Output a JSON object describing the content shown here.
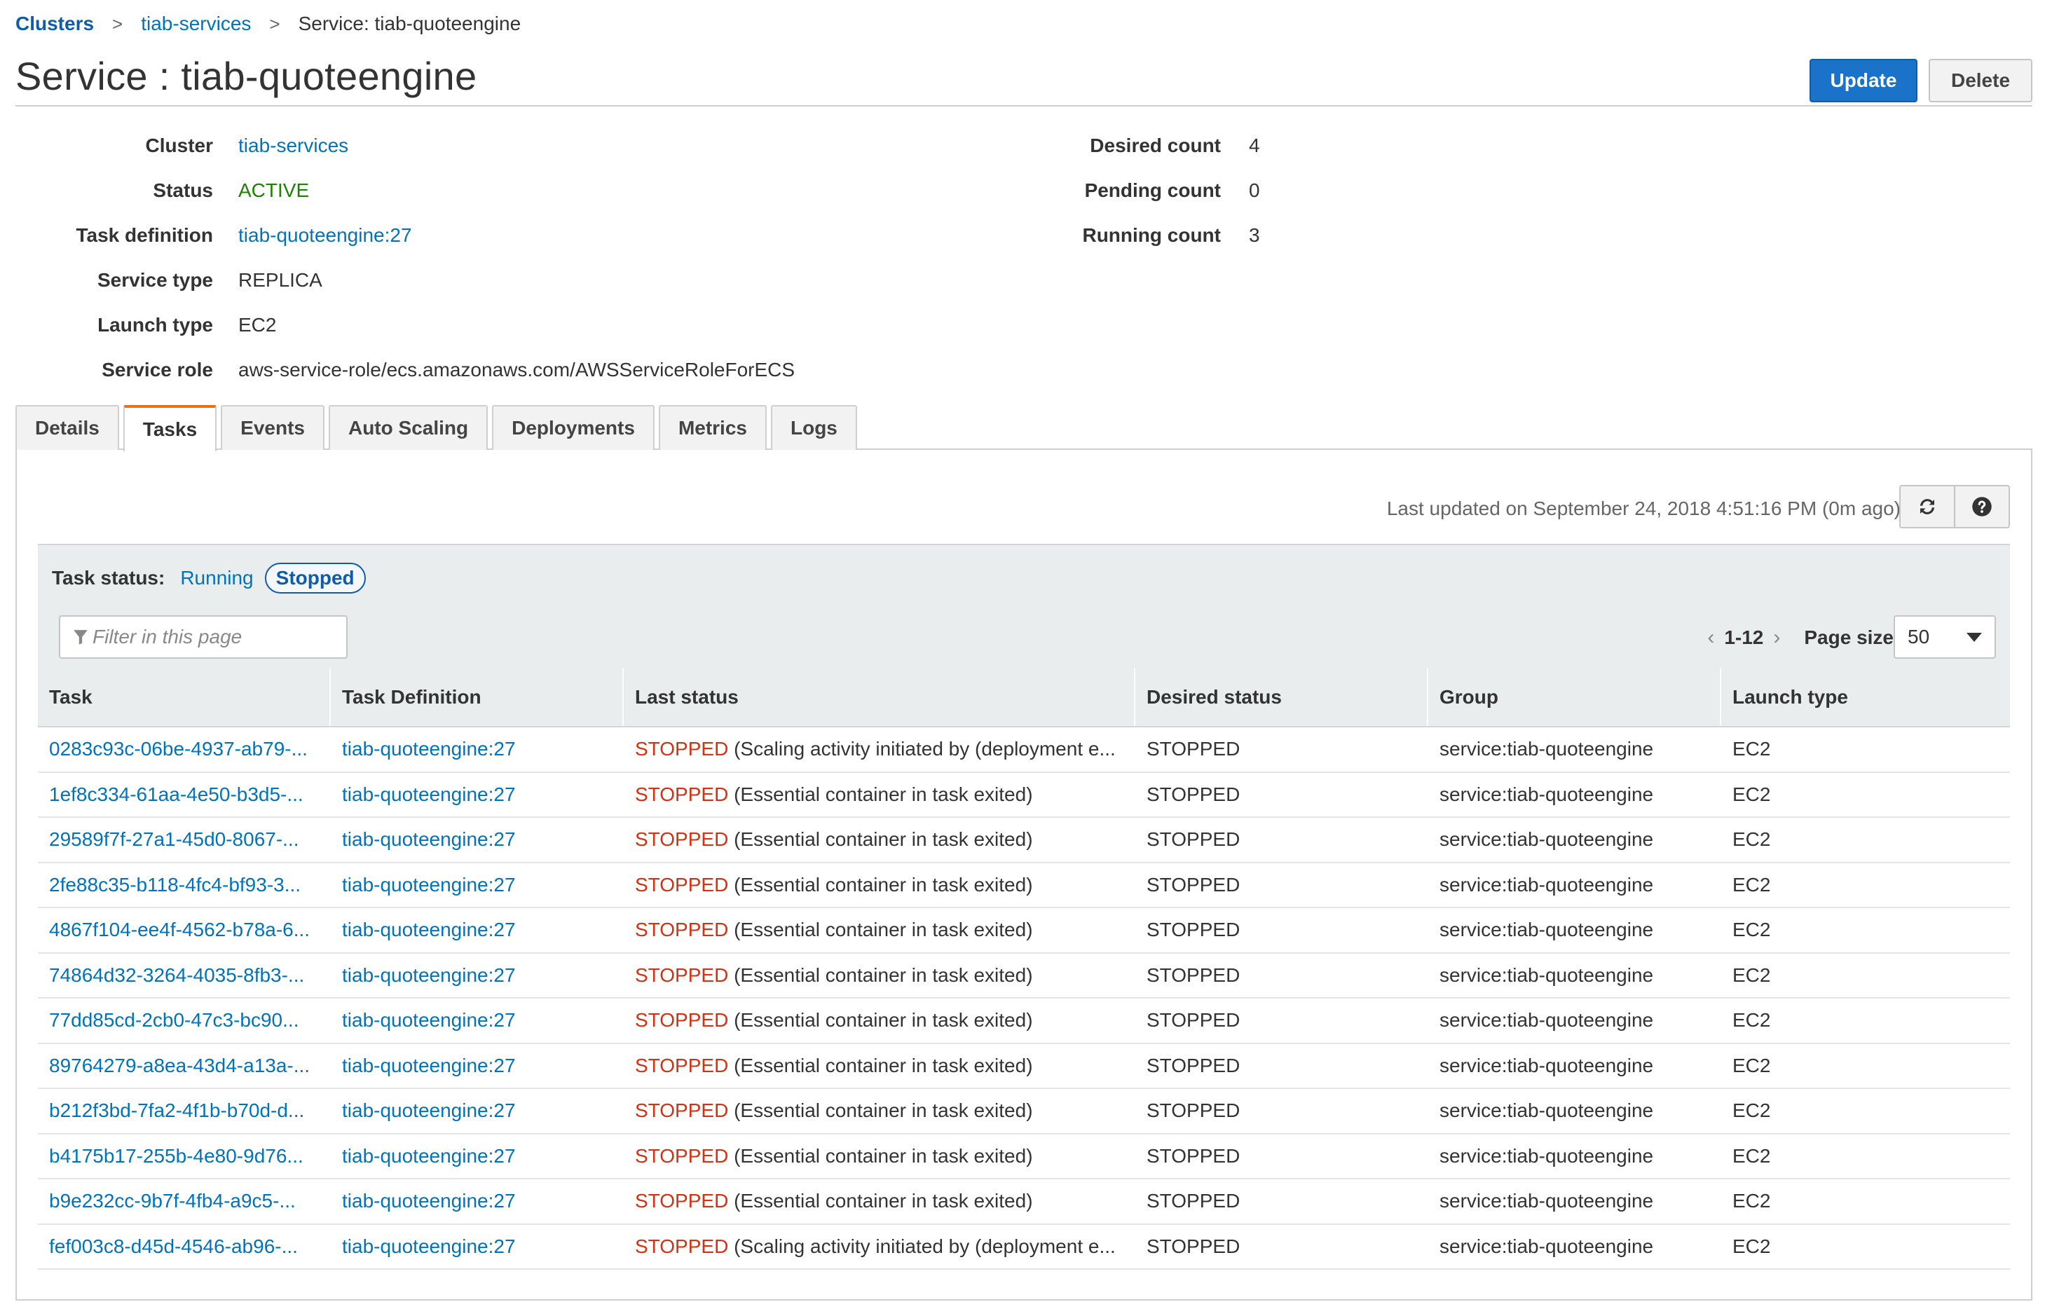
{
  "breadcrumb": {
    "items": [
      {
        "label": "Clusters"
      },
      {
        "label": "tiab-services"
      },
      {
        "label": "Service: tiab-quoteengine"
      }
    ],
    "separator": ">"
  },
  "page_title": "Service : tiab-quoteengine",
  "actions": {
    "update_label": "Update",
    "delete_label": "Delete"
  },
  "details_left": [
    {
      "label": "Cluster",
      "value": "tiab-services"
    },
    {
      "label": "Status",
      "value": "ACTIVE"
    },
    {
      "label": "Task definition",
      "value": "tiab-quoteengine:27"
    },
    {
      "label": "Service type",
      "value": "REPLICA"
    },
    {
      "label": "Launch type",
      "value": "EC2"
    },
    {
      "label": "Service role",
      "value": "aws-service-role/ecs.amazonaws.com/AWSServiceRoleForECS"
    }
  ],
  "details_right": [
    {
      "label": "Desired count",
      "value": "4"
    },
    {
      "label": "Pending count",
      "value": "0"
    },
    {
      "label": "Running count",
      "value": "3"
    }
  ],
  "tabs": [
    "Details",
    "Tasks",
    "Events",
    "Auto Scaling",
    "Deployments",
    "Metrics",
    "Logs"
  ],
  "active_tab": "Tasks",
  "last_updated": "Last updated on September 24, 2018 4:51:16 PM (0m ago)",
  "task_status": {
    "label": "Task status:",
    "running": "Running",
    "stopped": "Stopped"
  },
  "filter": {
    "placeholder": "Filter in this page"
  },
  "pager": {
    "range": "1-12",
    "page_size_label": "Page size",
    "page_size": "50"
  },
  "table": {
    "columns": [
      "Task",
      "Task Definition",
      "Last status",
      "Desired status",
      "Group",
      "Launch type"
    ],
    "rows": [
      {
        "task": "0283c93c-06be-4937-ab79-...",
        "task_def": "tiab-quoteengine:27",
        "status": "STOPPED",
        "reason": "(Scaling activity initiated by (deployment e...",
        "desired": "STOPPED",
        "group": "service:tiab-quoteengine",
        "launch": "EC2"
      },
      {
        "task": "1ef8c334-61aa-4e50-b3d5-...",
        "task_def": "tiab-quoteengine:27",
        "status": "STOPPED",
        "reason": "(Essential container in task exited)",
        "desired": "STOPPED",
        "group": "service:tiab-quoteengine",
        "launch": "EC2"
      },
      {
        "task": "29589f7f-27a1-45d0-8067-...",
        "task_def": "tiab-quoteengine:27",
        "status": "STOPPED",
        "reason": "(Essential container in task exited)",
        "desired": "STOPPED",
        "group": "service:tiab-quoteengine",
        "launch": "EC2"
      },
      {
        "task": "2fe88c35-b118-4fc4-bf93-3...",
        "task_def": "tiab-quoteengine:27",
        "status": "STOPPED",
        "reason": "(Essential container in task exited)",
        "desired": "STOPPED",
        "group": "service:tiab-quoteengine",
        "launch": "EC2"
      },
      {
        "task": "4867f104-ee4f-4562-b78a-6...",
        "task_def": "tiab-quoteengine:27",
        "status": "STOPPED",
        "reason": "(Essential container in task exited)",
        "desired": "STOPPED",
        "group": "service:tiab-quoteengine",
        "launch": "EC2"
      },
      {
        "task": "74864d32-3264-4035-8fb3-...",
        "task_def": "tiab-quoteengine:27",
        "status": "STOPPED",
        "reason": "(Essential container in task exited)",
        "desired": "STOPPED",
        "group": "service:tiab-quoteengine",
        "launch": "EC2"
      },
      {
        "task": "77dd85cd-2cb0-47c3-bc90...",
        "task_def": "tiab-quoteengine:27",
        "status": "STOPPED",
        "reason": "(Essential container in task exited)",
        "desired": "STOPPED",
        "group": "service:tiab-quoteengine",
        "launch": "EC2"
      },
      {
        "task": "89764279-a8ea-43d4-a13a-...",
        "task_def": "tiab-quoteengine:27",
        "status": "STOPPED",
        "reason": "(Essential container in task exited)",
        "desired": "STOPPED",
        "group": "service:tiab-quoteengine",
        "launch": "EC2"
      },
      {
        "task": "b212f3bd-7fa2-4f1b-b70d-d...",
        "task_def": "tiab-quoteengine:27",
        "status": "STOPPED",
        "reason": "(Essential container in task exited)",
        "desired": "STOPPED",
        "group": "service:tiab-quoteengine",
        "launch": "EC2"
      },
      {
        "task": "b4175b17-255b-4e80-9d76...",
        "task_def": "tiab-quoteengine:27",
        "status": "STOPPED",
        "reason": "(Essential container in task exited)",
        "desired": "STOPPED",
        "group": "service:tiab-quoteengine",
        "launch": "EC2"
      },
      {
        "task": "b9e232cc-9b7f-4fb4-a9c5-...",
        "task_def": "tiab-quoteengine:27",
        "status": "STOPPED",
        "reason": "(Essential container in task exited)",
        "desired": "STOPPED",
        "group": "service:tiab-quoteengine",
        "launch": "EC2"
      },
      {
        "task": "fef003c8-d45d-4546-ab96-...",
        "task_def": "tiab-quoteengine:27",
        "status": "STOPPED",
        "reason": "(Scaling activity initiated by (deployment e...",
        "desired": "STOPPED",
        "group": "service:tiab-quoteengine",
        "launch": "EC2"
      }
    ]
  },
  "colors": {
    "link": "#0073bb",
    "primary": "#1a73c9",
    "active_green": "#1d8102",
    "stopped_red": "#d13212",
    "tab_accent": "#ec7211"
  },
  "icons": {
    "refresh": "refresh-icon",
    "help": "help-icon",
    "filter": "filter-icon",
    "prev": "chevron-left-icon",
    "next": "chevron-right-icon",
    "dropdown": "caret-down-icon"
  }
}
